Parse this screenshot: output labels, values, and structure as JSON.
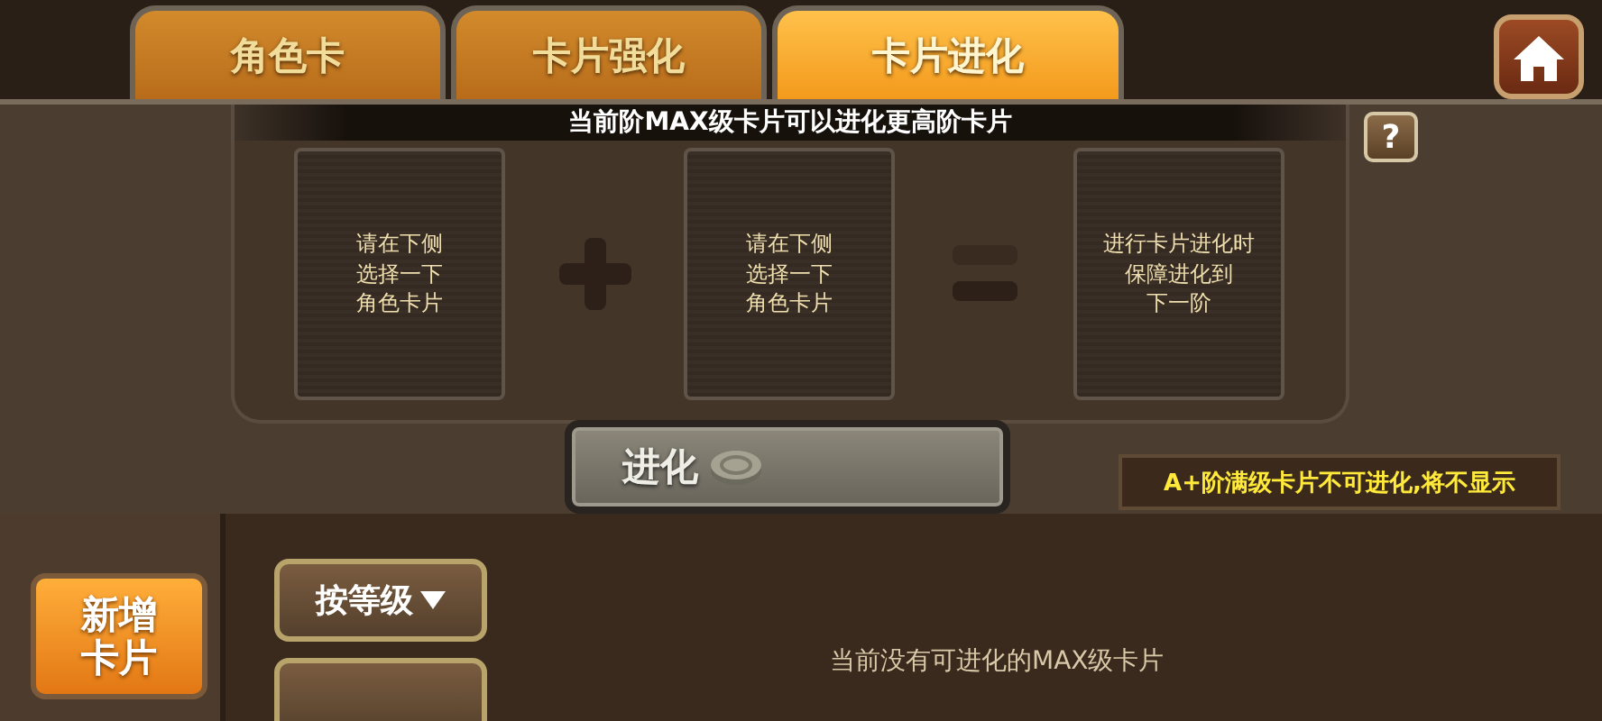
{
  "tabs": [
    {
      "label": "角色卡",
      "selected": false
    },
    {
      "label": "卡片强化",
      "selected": false
    },
    {
      "label": "卡片进化",
      "selected": true
    }
  ],
  "help_button": "?",
  "banner": "当前阶MAX级卡片可以进化更高阶卡片",
  "slots": [
    {
      "kind": "card",
      "lines": [
        "请在下侧",
        "选择一下",
        "角色卡片"
      ]
    },
    {
      "kind": "plus"
    },
    {
      "kind": "card",
      "lines": [
        "请在下侧",
        "选择一下",
        "角色卡片"
      ]
    },
    {
      "kind": "equals"
    },
    {
      "kind": "card",
      "lines": [
        "进行卡片进化时",
        "保障进化到",
        "下一阶"
      ]
    }
  ],
  "evolve_button": {
    "label": "进化",
    "disabled": true
  },
  "notice": "A+阶满级卡片不可进化,将不显示",
  "add_card_button": "新增卡片",
  "sort_button": "按等级",
  "empty_message": "当前没有可进化的MAX级卡片"
}
